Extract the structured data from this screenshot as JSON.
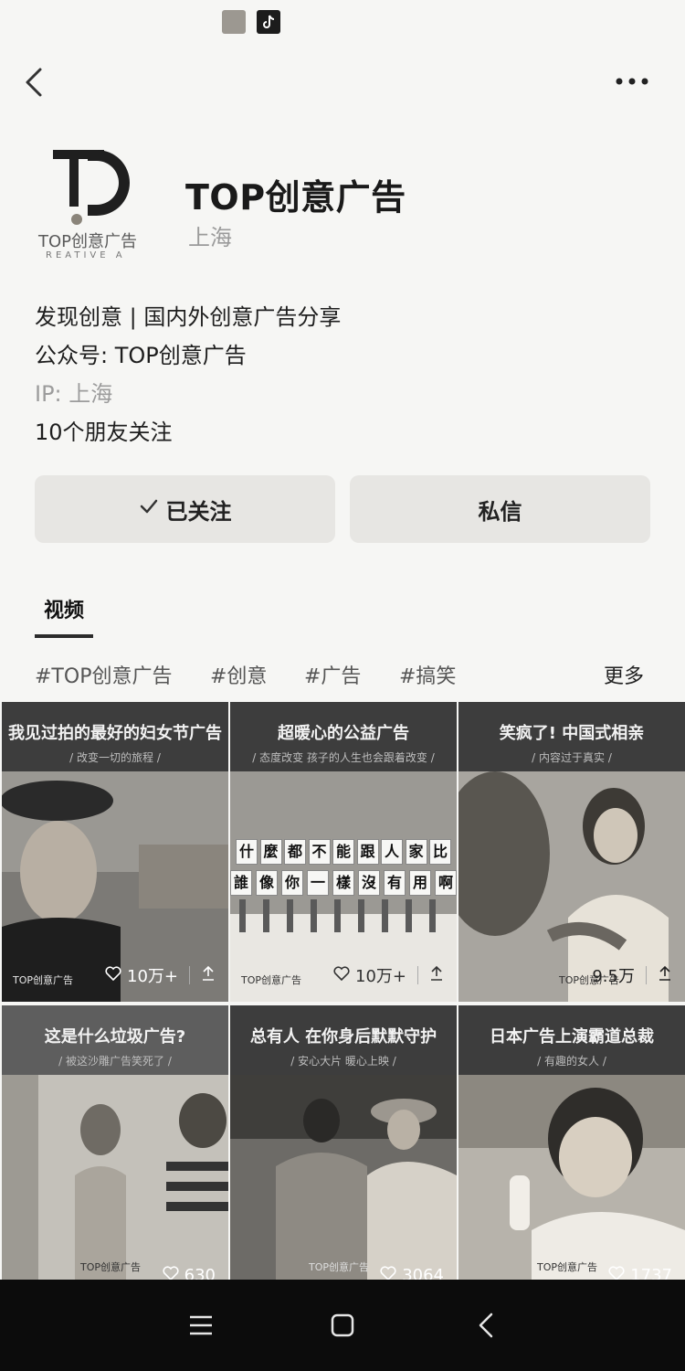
{
  "profile": {
    "name": "TOP创意广告",
    "location": "上海"
  },
  "logo": {
    "text": "TOP创意广告",
    "sub": "REATIVE A"
  },
  "bio": {
    "line1": "发现创意 | 国内外创意广告分享",
    "line2": "公众号: TOP创意广告",
    "line3": "IP: 上海",
    "line4": "10个朋友关注"
  },
  "actions": {
    "follow": "已关注",
    "message": "私信"
  },
  "tabs": {
    "video": "视频"
  },
  "hashtags": [
    "#TOP创意广告",
    "#创意",
    "#广告",
    "#搞笑"
  ],
  "more": "更多",
  "videos": [
    {
      "title": "我见过拍的最好的妇女节广告",
      "subtitle": "/ 改变一切的旅程 /",
      "brand": "TOP创意广告",
      "likes": "10万+"
    },
    {
      "title": "超暖心的公益广告",
      "subtitle": "/ 态度改变 孩子的人生也会跟着改变 /",
      "brand": "TOP创意广告",
      "likes": "10万+"
    },
    {
      "title": "笑疯了! 中国式相亲",
      "subtitle": "/ 内容过于真实 /",
      "brand": "TOP创意广告",
      "likes": "9.5万"
    },
    {
      "title": "这是什么垃圾广告?",
      "subtitle": "/ 被这沙雕广告笑死了 /",
      "brand": "TOP创意广告",
      "likes": "630"
    },
    {
      "title": "总有人 在你身后默默守护",
      "subtitle": "/ 安心大片 暖心上映 /",
      "brand": "TOP创意广告",
      "likes": "3064"
    },
    {
      "title": "日本广告上演霸道总裁",
      "subtitle": "/ 有趣的女人 /",
      "brand": "TOP创意广告",
      "likes": "1737"
    }
  ],
  "tile2_signs": {
    "row1": [
      "什",
      "麼",
      "都",
      "不",
      "能",
      "跟",
      "人",
      "家",
      "比"
    ],
    "row2": [
      "誰",
      "像",
      "你",
      "一",
      "樣",
      "沒",
      "有",
      "用",
      "啊"
    ]
  }
}
